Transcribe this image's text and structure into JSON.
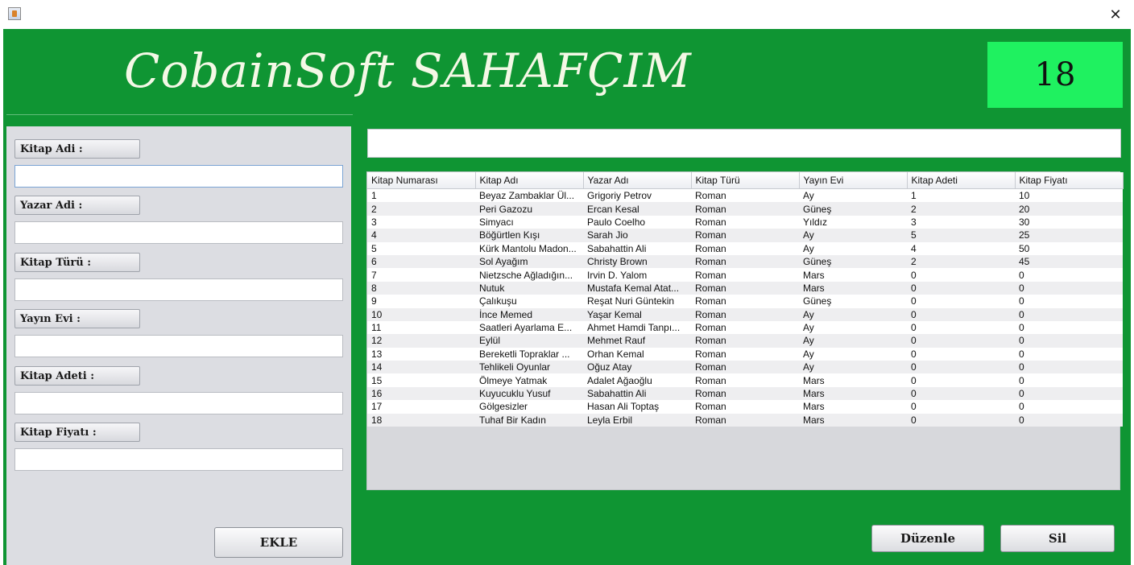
{
  "window": {
    "close_glyph": "✕"
  },
  "header": {
    "title": "CobainSoft SAHAFÇIM",
    "counter": "18"
  },
  "form": {
    "fields": [
      {
        "label": "Kitap Adi :",
        "value": ""
      },
      {
        "label": "Yazar Adi :",
        "value": ""
      },
      {
        "label": "Kitap Türü :",
        "value": ""
      },
      {
        "label": "Yayın Evi :",
        "value": ""
      },
      {
        "label": "Kitap Adeti :",
        "value": ""
      },
      {
        "label": "Kitap Fiyatı :",
        "value": ""
      }
    ],
    "add_label": "EKLE"
  },
  "search": {
    "value": ""
  },
  "table": {
    "columns": [
      "Kitap Numarası",
      "Kitap Adı",
      "Yazar Adı",
      "Kitap Türü",
      "Yayın Evi",
      "Kitap Adeti",
      "Kitap Fiyatı"
    ],
    "rows": [
      [
        "1",
        "Beyaz Zambaklar Ül...",
        "Grigoriy Petrov",
        "Roman",
        "Ay",
        "1",
        "10"
      ],
      [
        "2",
        "Peri Gazozu",
        "Ercan Kesal",
        "Roman",
        "Güneş",
        "2",
        "20"
      ],
      [
        "3",
        "Simyacı",
        "Paulo Coelho",
        "Roman",
        "Yıldız",
        "3",
        "30"
      ],
      [
        "4",
        "Böğürtlen Kışı",
        "Sarah Jio",
        "Roman",
        "Ay",
        "5",
        "25"
      ],
      [
        "5",
        "Kürk Mantolu Madon...",
        "Sabahattin Ali",
        "Roman",
        "Ay",
        "4",
        "50"
      ],
      [
        "6",
        "Sol Ayağım",
        "Christy Brown",
        "Roman",
        "Güneş",
        "2",
        "45"
      ],
      [
        "7",
        "Nietzsche Ağladığın...",
        "Irvin D. Yalom",
        "Roman",
        "Mars",
        "0",
        "0"
      ],
      [
        "8",
        "Nutuk",
        "Mustafa Kemal Atat...",
        "Roman",
        "Mars",
        "0",
        "0"
      ],
      [
        "9",
        "Çalıkuşu",
        "Reşat Nuri Güntekin",
        "Roman",
        "Güneş",
        "0",
        "0"
      ],
      [
        "10",
        "İnce Memed",
        "Yaşar Kemal",
        "Roman",
        "Ay",
        "0",
        "0"
      ],
      [
        "11",
        "Saatleri Ayarlama E...",
        "Ahmet Hamdi Tanpı...",
        "Roman",
        "Ay",
        "0",
        "0"
      ],
      [
        "12",
        "Eylül",
        "Mehmet Rauf",
        "Roman",
        "Ay",
        "0",
        "0"
      ],
      [
        "13",
        "Bereketli Topraklar ...",
        "Orhan Kemal",
        "Roman",
        "Ay",
        "0",
        "0"
      ],
      [
        "14",
        "Tehlikeli Oyunlar",
        "Oğuz Atay",
        "Roman",
        "Ay",
        "0",
        "0"
      ],
      [
        "15",
        "Ölmeye Yatmak",
        "Adalet Ağaoğlu",
        "Roman",
        "Mars",
        "0",
        "0"
      ],
      [
        "16",
        "Kuyucuklu Yusuf",
        "Sabahattin Ali",
        "Roman",
        "Mars",
        "0",
        "0"
      ],
      [
        "17",
        "Gölgesizler",
        "Hasan Ali Toptaş",
        "Roman",
        "Mars",
        "0",
        "0"
      ],
      [
        "18",
        "Tuhaf Bir Kadın",
        "Leyla Erbil",
        "Roman",
        "Mars",
        "0",
        "0"
      ]
    ]
  },
  "actions": {
    "edit_label": "Düzenle",
    "delete_label": "Sil"
  },
  "colors": {
    "accent_green": "#0f9533",
    "counter_green": "#1ff160"
  }
}
